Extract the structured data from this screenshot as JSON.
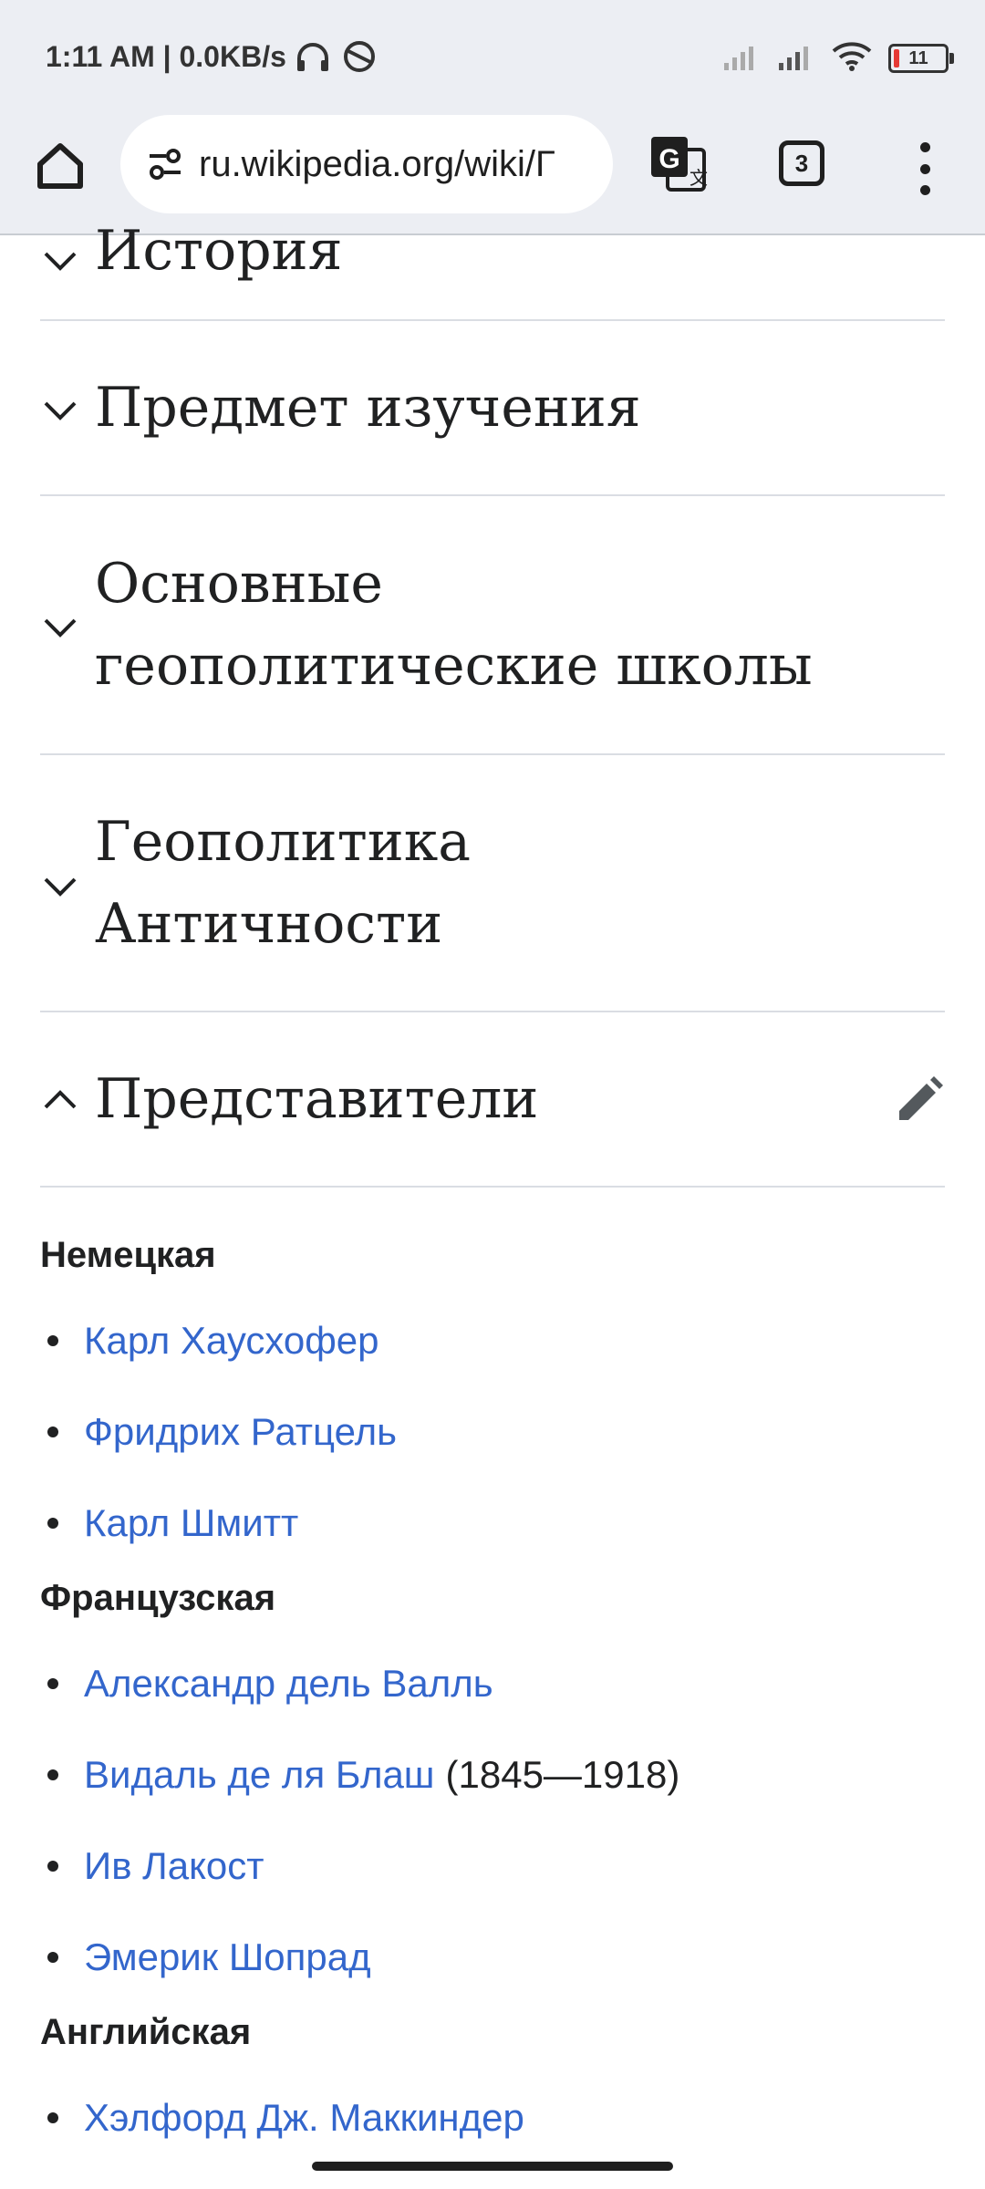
{
  "status_bar": {
    "time": "1:11 AM | 0.0KB/s",
    "battery_level": "11"
  },
  "browser": {
    "url": "ru.wikipedia.org/wiki/Г",
    "tab_count": "3"
  },
  "sections": [
    {
      "title_line1": "История",
      "title_line2": "",
      "expanded": false
    },
    {
      "title_line1": "Предмет изучения",
      "title_line2": "",
      "expanded": false
    },
    {
      "title_line1": "Основные",
      "title_line2": "геополитические школы",
      "expanded": false
    },
    {
      "title_line1": "Геополитика",
      "title_line2": "Античности",
      "expanded": false
    },
    {
      "title_line1": "Представители",
      "title_line2": "",
      "expanded": true
    }
  ],
  "schools": [
    {
      "heading": "Немецкая",
      "people": [
        {
          "name": "Карл Хаусхофер",
          "extra": ""
        },
        {
          "name": "Фридрих Ратцель",
          "extra": ""
        },
        {
          "name": "Карл Шмитт",
          "extra": ""
        }
      ]
    },
    {
      "heading": "Французская",
      "people": [
        {
          "name": "Александр дель Валль",
          "extra": ""
        },
        {
          "name": "Видаль де ля Блаш",
          "extra": "(1845—1918)"
        },
        {
          "name": "Ив Лакост",
          "extra": ""
        },
        {
          "name": "Эмерик Шопрад",
          "extra": ""
        }
      ]
    },
    {
      "heading": "Английская",
      "people": [
        {
          "name": "Хэлфорд Дж. Маккиндер",
          "extra": ""
        }
      ]
    }
  ]
}
